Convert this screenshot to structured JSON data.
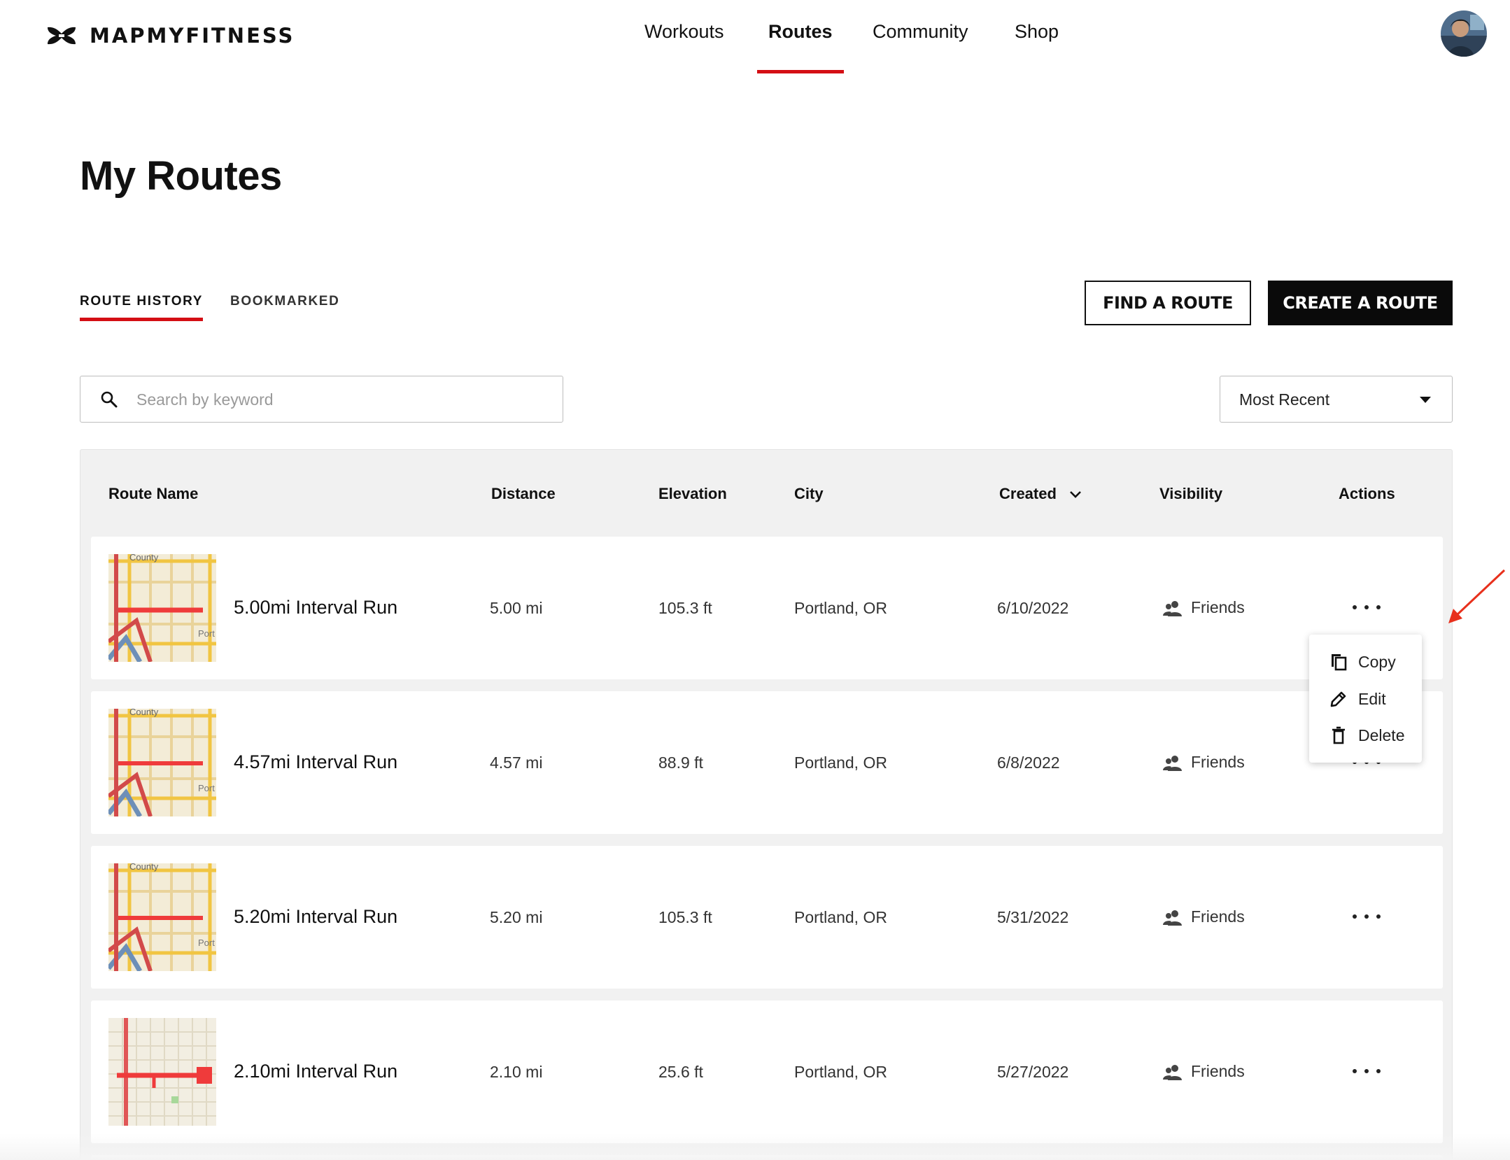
{
  "header": {
    "brand": "MAPMYFITNESS",
    "nav": [
      {
        "label": "Workouts",
        "active": false
      },
      {
        "label": "Routes",
        "active": true
      },
      {
        "label": "Community",
        "active": false
      },
      {
        "label": "Shop",
        "active": false
      }
    ]
  },
  "page": {
    "title": "My Routes",
    "tabs": [
      {
        "label": "ROUTE HISTORY",
        "active": true
      },
      {
        "label": "BOOKMARKED",
        "active": false
      }
    ],
    "buttons": {
      "find": "FIND A ROUTE",
      "create": "CREATE A ROUTE"
    },
    "search": {
      "placeholder": "Search by keyword",
      "value": ""
    },
    "sort": {
      "selected": "Most Recent"
    }
  },
  "table": {
    "columns": [
      "Route Name",
      "Distance",
      "Elevation",
      "City",
      "Created",
      "Visibility",
      "Actions"
    ],
    "rows": [
      {
        "name": "5.00mi Interval Run",
        "distance": "5.00 mi",
        "elevation": "105.3 ft",
        "city": "Portland, OR",
        "created": "6/10/2022",
        "visibility": "Friends",
        "map_label_top": "County",
        "map_label_bottom": "Port"
      },
      {
        "name": "4.57mi Interval Run",
        "distance": "4.57 mi",
        "elevation": "88.9 ft",
        "city": "Portland, OR",
        "created": "6/8/2022",
        "visibility": "Friends",
        "map_label_top": "County",
        "map_label_bottom": "Port"
      },
      {
        "name": "5.20mi Interval Run",
        "distance": "5.20 mi",
        "elevation": "105.3 ft",
        "city": "Portland, OR",
        "created": "5/31/2022",
        "visibility": "Friends",
        "map_label_top": "County",
        "map_label_bottom": "Port"
      },
      {
        "name": "2.10mi Interval Run",
        "distance": "2.10 mi",
        "elevation": "25.6 ft",
        "city": "Portland, OR",
        "created": "5/27/2022",
        "visibility": "Friends"
      }
    ]
  },
  "actions_menu": {
    "items": [
      {
        "label": "Copy",
        "icon": "copy-icon"
      },
      {
        "label": "Edit",
        "icon": "pencil-icon"
      },
      {
        "label": "Delete",
        "icon": "trash-icon"
      }
    ]
  },
  "colors": {
    "accent": "#d40e14",
    "primary_button": "#0a0a0a",
    "table_bg": "#f1f1f1",
    "annotation_arrow": "#e8301c"
  }
}
